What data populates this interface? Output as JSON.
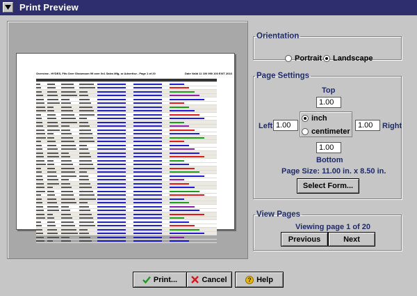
{
  "window": {
    "title": "Print Preview"
  },
  "preview": {
    "header_left": "Overview - HYDES, Fifo Over Showroom 99 over 0x1 Sales Mfg, or Advertise - Page 1 of 20",
    "header_right": "Date Valid 11 100 990 100 EXIT 2016",
    "row_colors": [
      "#1c1cd8",
      "#e01818",
      "#1c9a1c",
      "#8a1cae",
      "#1c1cd8",
      "#e01818",
      "#1c9a1c",
      "#1c1cd8",
      "#e01818",
      "#1c1cd8",
      "#1c9a1c",
      "#8a1cae",
      "#e01818",
      "#1c1cd8",
      "#1c9a1c",
      "#e01818",
      "#1c1cd8",
      "#8a1cae",
      "#1c1cd8",
      "#e01818",
      "#1c9a1c",
      "#1c1cd8",
      "#e01818",
      "#1c9a1c",
      "#1c1cd8",
      "#8a1cae",
      "#e01818",
      "#1c1cd8",
      "#1c9a1c",
      "#e01818",
      "#1c1cd8",
      "#1c9a1c",
      "#8a1cae",
      "#1c1cd8",
      "#e01818",
      "#1c9a1c",
      "#1c1cd8",
      "#e01818",
      "#1c9a1c",
      "#1c1cd8",
      "#8a1cae",
      "#1c1cd8"
    ]
  },
  "orientation": {
    "legend": "Orientation",
    "portrait_label": "Portrait",
    "landscape_label": "Landscape",
    "selected": "Landscape"
  },
  "page_settings": {
    "legend": "Page Settings",
    "top_label": "Top",
    "top_value": "1.00",
    "left_label": "Left",
    "left_value": "1.00",
    "right_label": "Right",
    "right_value": "1.00",
    "bottom_label": "Bottom",
    "bottom_value": "1.00",
    "inch_label": "inch",
    "centimeter_label": "centimeter",
    "selected_unit": "inch",
    "page_size_text": "Page Size:  11.00 in. x 8.50 in.",
    "select_form_label": "Select Form..."
  },
  "view_pages": {
    "legend": "View Pages",
    "status_text": "Viewing page 1 of 20",
    "previous_label": "Previous",
    "next_label": "Next"
  },
  "footer": {
    "print_label": "Print...",
    "cancel_label": "Cancel",
    "help_label": "Help"
  },
  "colors": {
    "title_bar": "#2e2e6e",
    "label_text": "#1e2a6a",
    "panel": "#c6c6c6"
  }
}
